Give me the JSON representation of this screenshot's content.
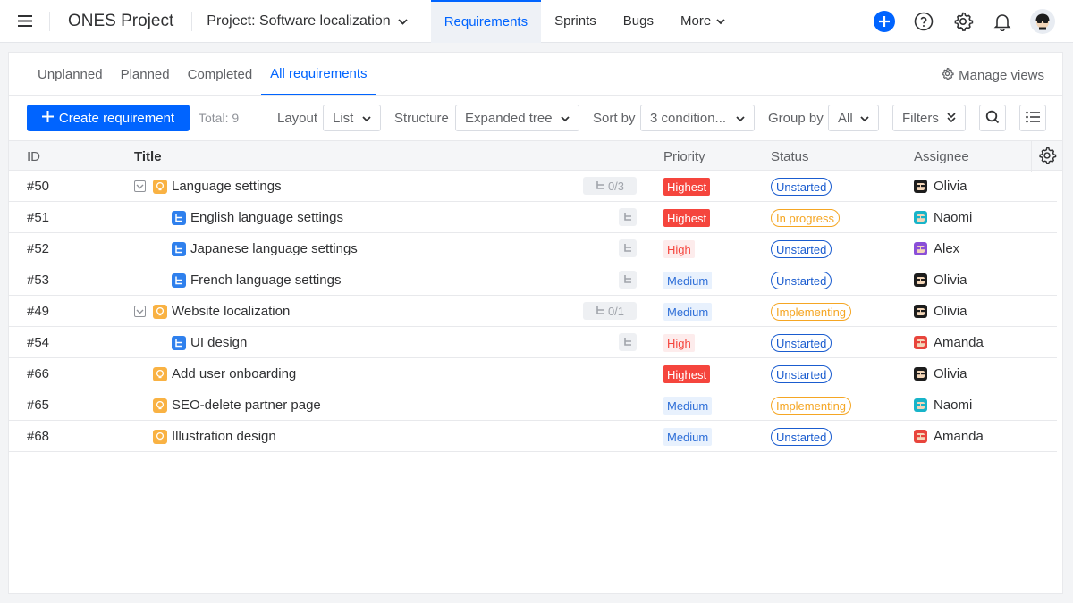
{
  "app": {
    "title": "ONES Project",
    "project_label": "Project: Software localization"
  },
  "nav": [
    {
      "label": "Requirements",
      "active": true
    },
    {
      "label": "Sprints",
      "active": false
    },
    {
      "label": "Bugs",
      "active": false
    },
    {
      "label": "More",
      "active": false
    }
  ],
  "top_icons": [
    "add-icon",
    "help-icon",
    "settings-icon",
    "notification-icon",
    "user-avatar"
  ],
  "colors": {
    "accent": "#0064ff",
    "highest": "#f5453d",
    "high_text": "#f5453d",
    "high_bg": "#fdecec",
    "medium_text": "#2f6fd8",
    "medium_bg": "#e8f1fd",
    "unstarted": "#1a5ccf",
    "in_progress": "#f5a623",
    "implementing": "#f5a623"
  },
  "view_tabs": [
    {
      "label": "Unplanned",
      "active": false
    },
    {
      "label": "Planned",
      "active": false
    },
    {
      "label": "Completed",
      "active": false
    },
    {
      "label": "All requirements",
      "active": true
    }
  ],
  "manage_views": "Manage views",
  "toolbar": {
    "create_label": "Create requirement",
    "total": "Total: 9",
    "layout_label": "Layout",
    "layout_value": "List",
    "structure_label": "Structure",
    "structure_value": "Expanded tree",
    "sort_label": "Sort by",
    "sort_value": "3 condition...",
    "group_label": "Group by",
    "group_value": "All",
    "filters_label": "Filters"
  },
  "table": {
    "headers": {
      "id": "ID",
      "title": "Title",
      "priority": "Priority",
      "status": "Status",
      "assignee": "Assignee"
    },
    "rows": [
      {
        "id": "#50",
        "title": "Language settings",
        "level": 0,
        "type": "requirement",
        "collapsible": true,
        "subtasks": "0/3",
        "priority": "Highest",
        "status": "Unstarted",
        "assignee": "Olivia",
        "avatar": "black"
      },
      {
        "id": "#51",
        "title": "English language settings",
        "level": 1,
        "type": "task",
        "collapsible": false,
        "subtasks": "",
        "priority": "Highest",
        "status": "In progress",
        "assignee": "Naomi",
        "avatar": "teal"
      },
      {
        "id": "#52",
        "title": "Japanese language settings",
        "level": 1,
        "type": "task",
        "collapsible": false,
        "subtasks": "",
        "priority": "High",
        "status": "Unstarted",
        "assignee": "Alex",
        "avatar": "purple"
      },
      {
        "id": "#53",
        "title": "French language settings",
        "level": 1,
        "type": "task",
        "collapsible": false,
        "subtasks": "",
        "priority": "Medium",
        "status": "Unstarted",
        "assignee": "Olivia",
        "avatar": "black"
      },
      {
        "id": "#49",
        "title": "Website localization",
        "level": 0,
        "type": "requirement",
        "collapsible": true,
        "subtasks": "0/1",
        "priority": "Medium",
        "status": "Implementing",
        "assignee": "Olivia",
        "avatar": "black"
      },
      {
        "id": "#54",
        "title": "UI design",
        "level": 1,
        "type": "task",
        "collapsible": false,
        "subtasks": "",
        "priority": "High",
        "status": "Unstarted",
        "assignee": "Amanda",
        "avatar": "red"
      },
      {
        "id": "#66",
        "title": "Add user onboarding",
        "level": 0,
        "type": "requirement",
        "collapsible": false,
        "subtasks": null,
        "priority": "Highest",
        "status": "Unstarted",
        "assignee": "Olivia",
        "avatar": "black"
      },
      {
        "id": "#65",
        "title": "SEO-delete partner page",
        "level": 0,
        "type": "requirement",
        "collapsible": false,
        "subtasks": null,
        "priority": "Medium",
        "status": "Implementing",
        "assignee": "Naomi",
        "avatar": "teal"
      },
      {
        "id": "#68",
        "title": "Illustration design",
        "level": 0,
        "type": "requirement",
        "collapsible": false,
        "subtasks": null,
        "priority": "Medium",
        "status": "Unstarted",
        "assignee": "Amanda",
        "avatar": "red"
      }
    ]
  }
}
